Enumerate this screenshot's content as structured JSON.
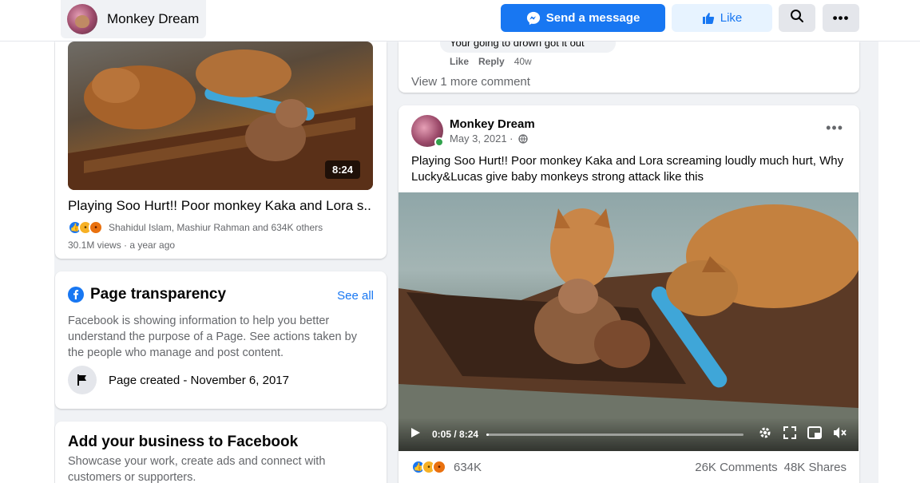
{
  "header": {
    "page_name": "Monkey Dream",
    "send_message": "Send a message",
    "like": "Like"
  },
  "left": {
    "video_card": {
      "duration": "8:24",
      "title": "Playing Soo Hurt!! Poor monkey Kaka and Lora s...",
      "reactions_text": "Shahidul Islam, Mashiur Rahman and 634K others",
      "meta": "30.1M views · a year ago"
    },
    "transparency": {
      "title": "Page transparency",
      "see_all": "See all",
      "body": "Facebook is showing information to help you better understand the purpose of a Page. See actions taken by the people who manage and post content.",
      "created": "Page created - November 6, 2017"
    },
    "business": {
      "title": "Add your business to Facebook",
      "body": "Showcase your work, create ads and connect with customers or supporters."
    }
  },
  "right": {
    "comment": {
      "text": "Your going to drown got it out",
      "like": "Like",
      "reply": "Reply",
      "time": "40w",
      "view_more": "View 1 more comment"
    },
    "post": {
      "author": "Monkey Dream",
      "date": "May 3, 2021 ·",
      "text": "Playing Soo Hurt!! Poor monkey Kaka and Lora screaming loudly much hurt, Why Lucky&Lucas give baby monkeys strong attack like this",
      "video_time": "0:05 / 8:24",
      "progress": 0.01,
      "reactions_count": "634K",
      "comments": "26K Comments",
      "shares": "48K Shares"
    }
  },
  "icons": [
    "messenger-icon",
    "thumbs-up-icon",
    "search-icon",
    "more-icon",
    "info-icon",
    "flag-icon",
    "globe-icon",
    "play-icon",
    "settings-icon",
    "fullscreen-icon",
    "pip-icon",
    "mute-icon"
  ],
  "colors": {
    "brand": "#1877f2",
    "feed_bg": "#f0f2f5",
    "online": "#31a24c"
  }
}
